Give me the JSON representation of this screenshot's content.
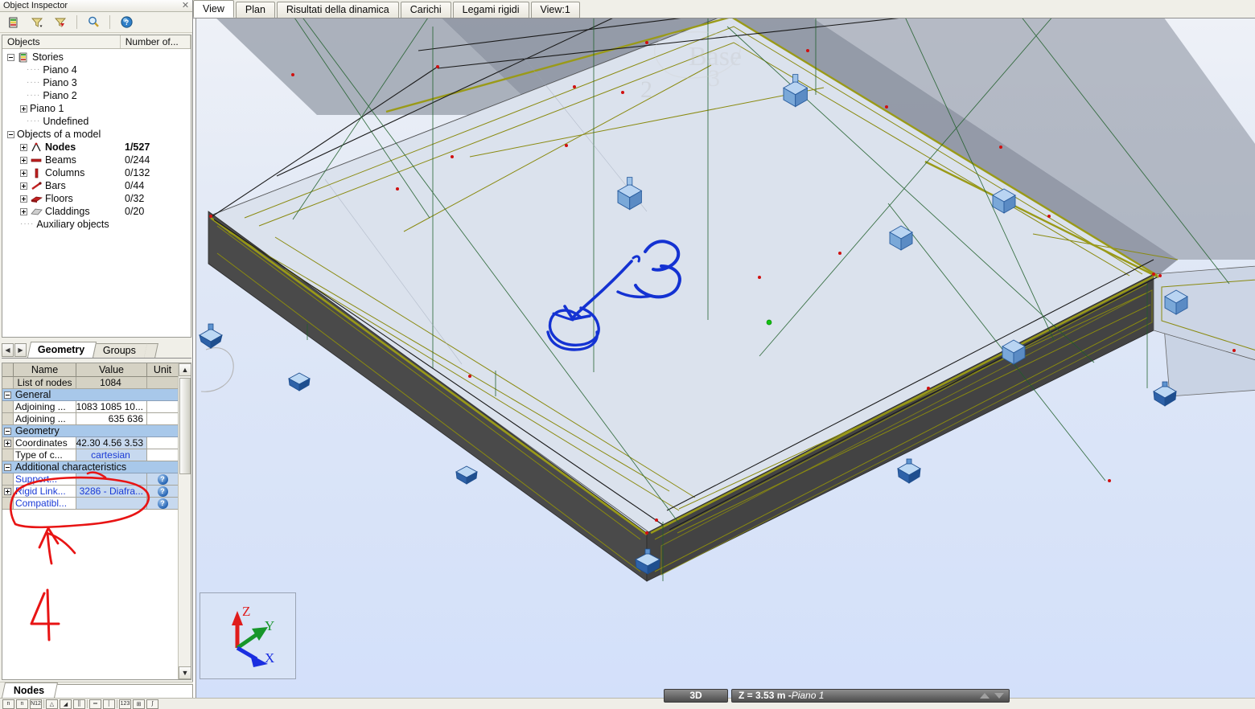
{
  "inspector": {
    "title": "Object Inspector",
    "close_icon": "close-icon",
    "toolbar": [
      {
        "name": "stories-icon",
        "tip": "Stories"
      },
      {
        "name": "filter-icon",
        "tip": "Filter"
      },
      {
        "name": "clear-filter-icon",
        "tip": "Clear filter"
      },
      {
        "name": "search-icon",
        "tip": "Find"
      },
      {
        "name": "help-icon",
        "tip": "Help"
      }
    ]
  },
  "tree": {
    "columns": [
      "Objects",
      "Number of..."
    ],
    "items": [
      {
        "label": "Stories",
        "count": "",
        "indent": 1,
        "toggle": "minus",
        "icon": "stories-icon",
        "bold": false
      },
      {
        "label": "Piano 4",
        "count": "",
        "indent": 3,
        "toggle": "none",
        "icon": "",
        "bold": false
      },
      {
        "label": "Piano 3",
        "count": "",
        "indent": 3,
        "toggle": "none",
        "icon": "",
        "bold": false
      },
      {
        "label": "Piano 2",
        "count": "",
        "indent": 3,
        "toggle": "none",
        "icon": "",
        "bold": false
      },
      {
        "label": "Piano 1",
        "count": "",
        "indent": 2,
        "toggle": "plus",
        "icon": "",
        "bold": false
      },
      {
        "label": "Undefined",
        "count": "",
        "indent": 3,
        "toggle": "none",
        "icon": "",
        "bold": false
      },
      {
        "label": "Objects of a model",
        "count": "",
        "indent": 1,
        "toggle": "minus",
        "icon": "",
        "bold": false
      },
      {
        "label": "Nodes",
        "count": "1/527",
        "indent": 2,
        "toggle": "plus",
        "icon": "node-icon",
        "bold": true
      },
      {
        "label": "Beams",
        "count": "0/244",
        "indent": 2,
        "toggle": "plus",
        "icon": "beam-icon",
        "bold": false
      },
      {
        "label": "Columns",
        "count": "0/132",
        "indent": 2,
        "toggle": "plus",
        "icon": "column-icon",
        "bold": false
      },
      {
        "label": "Bars",
        "count": "0/44",
        "indent": 2,
        "toggle": "plus",
        "icon": "bar-icon",
        "bold": false
      },
      {
        "label": "Floors",
        "count": "0/32",
        "indent": 2,
        "toggle": "plus",
        "icon": "floor-icon",
        "bold": false
      },
      {
        "label": "Claddings",
        "count": "0/20",
        "indent": 2,
        "toggle": "plus",
        "icon": "cladding-icon",
        "bold": false
      },
      {
        "label": "Auxiliary objects",
        "count": "",
        "indent": 2,
        "toggle": "none",
        "icon": "",
        "bold": false
      }
    ]
  },
  "geometry_tabs": {
    "prev_icon": "chevron-left-icon",
    "next_icon": "chevron-right-icon",
    "tabs": [
      {
        "label": "Geometry",
        "active": true
      },
      {
        "label": "Groups",
        "active": false
      }
    ]
  },
  "properties": {
    "columns": [
      "Name",
      "Value",
      "Unit"
    ],
    "rows": [
      {
        "kind": "plain",
        "toggle": "none",
        "name": "List of nodes",
        "value": "1084",
        "unit": "",
        "help": false
      },
      {
        "kind": "section",
        "toggle": "minus",
        "name": "General",
        "value": "",
        "unit": "",
        "help": false
      },
      {
        "kind": "normal",
        "toggle": "none",
        "name": "Adjoining ...",
        "value": "1083 1085 10...",
        "unit": "",
        "help": false
      },
      {
        "kind": "normal",
        "toggle": "none",
        "name": "Adjoining ...",
        "value": "635 636",
        "unit": "",
        "help": false
      },
      {
        "kind": "section",
        "toggle": "minus",
        "name": "Geometry",
        "value": "",
        "unit": "",
        "help": false
      },
      {
        "kind": "hl",
        "toggle": "plus",
        "name": "Coordinates",
        "value": "42.30 4.56 3.53",
        "unit": "",
        "help": false
      },
      {
        "kind": "hlblue",
        "toggle": "none",
        "name": "Type of c...",
        "value": "cartesian",
        "unit": "",
        "help": false
      },
      {
        "kind": "section",
        "toggle": "minus",
        "name": "Additional characteristics",
        "value": "",
        "unit": "",
        "help": false
      },
      {
        "kind": "blue",
        "toggle": "none",
        "name": "Support...",
        "value": "",
        "unit": "",
        "help": true
      },
      {
        "kind": "blue",
        "toggle": "plus",
        "name": "Rigid Link...",
        "value": "3286 - Diafra...",
        "unit": "",
        "help": true
      },
      {
        "kind": "blue",
        "toggle": "none",
        "name": "Compatibl...",
        "value": "",
        "unit": "",
        "help": true
      }
    ],
    "scroll_up_icon": "chevron-up-icon",
    "scroll_down_icon": "chevron-down-icon"
  },
  "nodes_tabs": {
    "tabs": [
      {
        "label": "Nodes",
        "active": true
      }
    ]
  },
  "bottom_toolbar": {
    "icons": [
      "node-number-icon",
      "node-label-icon",
      "n12-icon",
      "angle-icon",
      "slope-icon",
      "column-icon",
      "beam-section-icon",
      "line-icon",
      "numbers-123-icon",
      "grid-snap-icon",
      "curve-icon"
    ]
  },
  "view": {
    "tabs": [
      {
        "label": "View",
        "active": true
      },
      {
        "label": "Plan",
        "active": false
      },
      {
        "label": "Risultati della dinamica",
        "active": false
      },
      {
        "label": "Carichi",
        "active": false
      },
      {
        "label": "Legami rigidi",
        "active": false
      },
      {
        "label": "View:1",
        "active": false
      }
    ],
    "watermark": {
      "text": "Base",
      "label_left": "2",
      "label_right": "3"
    },
    "annotations": [
      {
        "name": "blue-marker-3",
        "text": "3",
        "color": "#1432d2"
      },
      {
        "name": "red-marker-4",
        "text": "4",
        "color": "#e81414"
      }
    ]
  },
  "axis_gizmo": {
    "axes": [
      {
        "label": "Z",
        "color": "#e01c1c"
      },
      {
        "label": "Y",
        "color": "#17962a"
      },
      {
        "label": "X",
        "color": "#1a2ee0"
      }
    ]
  },
  "status": {
    "mode_label": "3D",
    "z_prefix": "Z = 3.53 m - ",
    "z_story": "Piano 1",
    "up_icon": "spinner-up-icon",
    "down_icon": "spinner-down-icon"
  },
  "colors": {
    "accent_blue": "#1a3ad6",
    "section_blue": "#a8c8ea",
    "annotation_blue": "#1432d2",
    "annotation_red": "#e81414",
    "canvas_bg": "#d5e1fa",
    "slab_dark": "#4a4a4a",
    "slab_light": "#ccd6e8",
    "edge_olive": "#8a8a10"
  }
}
